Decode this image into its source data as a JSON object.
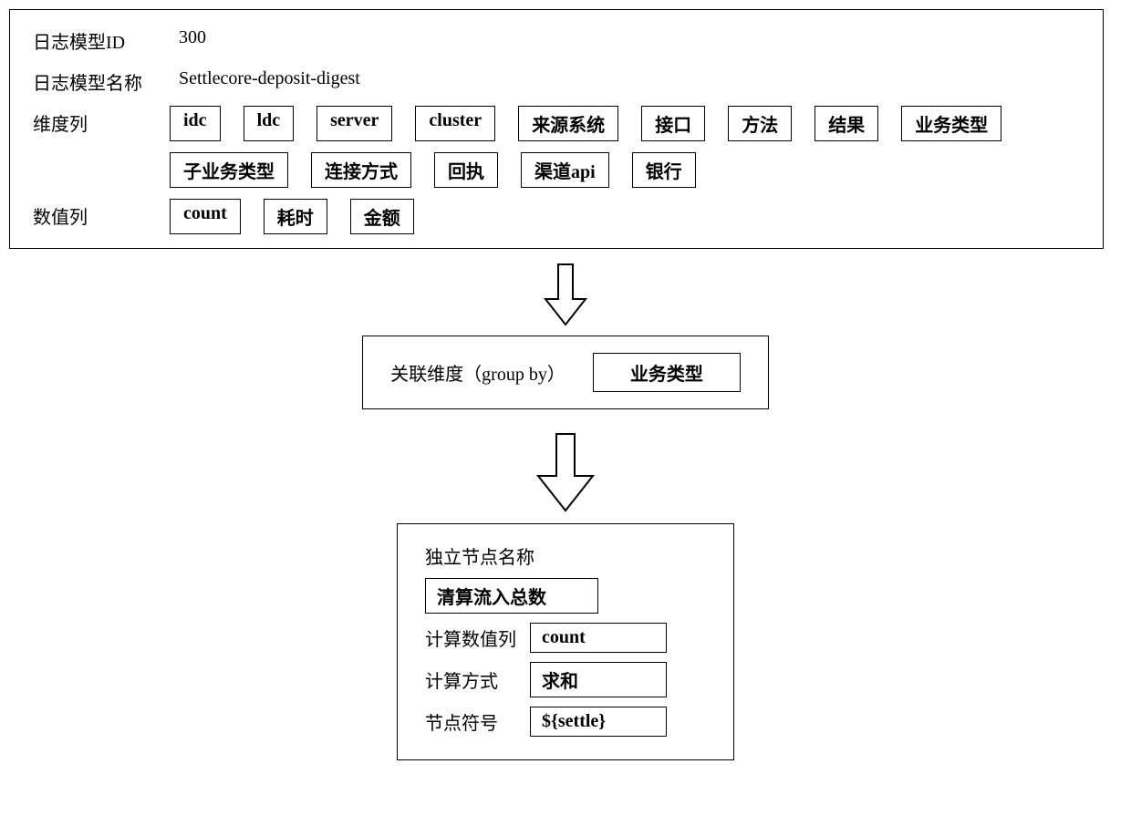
{
  "top": {
    "idLabel": "日志模型ID",
    "idValue": "300",
    "nameLabel": "日志模型名称",
    "nameValue": "Settlecore-deposit-digest",
    "dimLabel": "维度列",
    "dims1": [
      "idc",
      "ldc",
      "server",
      "cluster",
      "来源系统",
      "接口",
      "方法",
      "结果",
      "业务类型"
    ],
    "dims2": [
      "子业务类型",
      "连接方式",
      "回执",
      "渠道api",
      "银行"
    ],
    "numLabel": "数值列",
    "nums": [
      "count",
      "耗时",
      "金额"
    ]
  },
  "mid": {
    "label": "关联维度（group by）",
    "value": "业务类型"
  },
  "bottom": {
    "title": "独立节点名称",
    "titleValue": "清算流入总数",
    "numColLabel": "计算数值列",
    "numColValue": "count",
    "methodLabel": "计算方式",
    "methodValue": "求和",
    "symbolLabel": "节点符号",
    "symbolValue": "${settle}"
  }
}
